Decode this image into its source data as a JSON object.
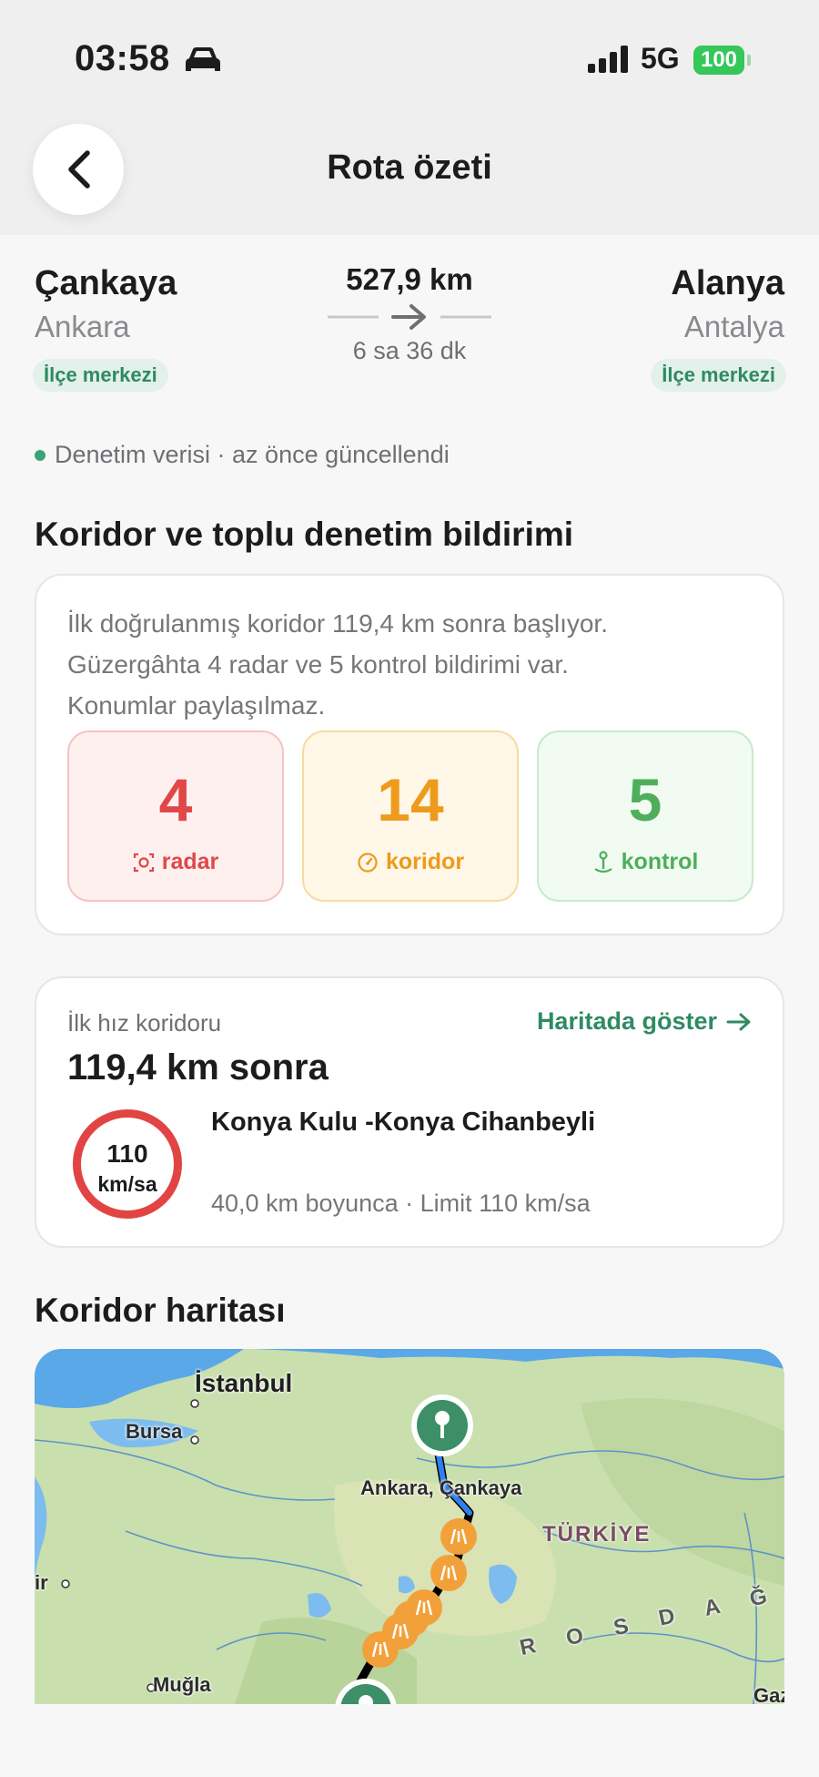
{
  "status_bar": {
    "time": "03:58",
    "network": "5G",
    "battery": "100",
    "icons": [
      "car-icon",
      "signal-icon",
      "battery-icon"
    ]
  },
  "header": {
    "title": "Rota özeti",
    "back_icon": "chevron-left-icon"
  },
  "route": {
    "from": {
      "city": "Çankaya",
      "region": "Ankara",
      "badge": "İlçe merkezi"
    },
    "to": {
      "city": "Alanya",
      "region": "Antalya",
      "badge": "İlçe merkezi"
    },
    "distance": "527,9 km",
    "duration": "6 sa 36 dk",
    "update_status": "Denetim verisi · az önce güncellendi"
  },
  "notice": {
    "title": "Koridor ve toplu denetim bildirimi",
    "text_lines": [
      "İlk doğrulanmış koridor 119,4 km sonra başlıyor.",
      "Güzergâhta 4 radar ve 5 kontrol bildirimi var.",
      "Konumlar paylaşılmaz."
    ],
    "stats": [
      {
        "value": "4",
        "label": "radar",
        "icon": "camera-icon",
        "color": "#e04848"
      },
      {
        "value": "14",
        "label": "koridor",
        "icon": "speedometer-icon",
        "color": "#ee9a1b"
      },
      {
        "value": "5",
        "label": "kontrol",
        "icon": "police-icon",
        "color": "#4fae5b"
      }
    ]
  },
  "first_corridor": {
    "label": "İlk hız koridoru",
    "link": "Haritada göster",
    "distance": "119,4 km sonra",
    "speed_limit": "110",
    "speed_unit": "km/sa",
    "name": "Konya Kulu -Konya Cihanbeyli",
    "detail": "40,0 km boyunca · Limit 110 km/sa"
  },
  "map": {
    "title": "Koridor haritası",
    "labels": {
      "istanbul": "İstanbul",
      "bursa": "Bursa",
      "ankara": "Ankara, Çankaya",
      "turkiye": "TÜRKİYE",
      "izmir": "ir",
      "mugla": "Muğla",
      "toros": "R O S  D A Ğ L",
      "gaz": "Gaz"
    }
  }
}
